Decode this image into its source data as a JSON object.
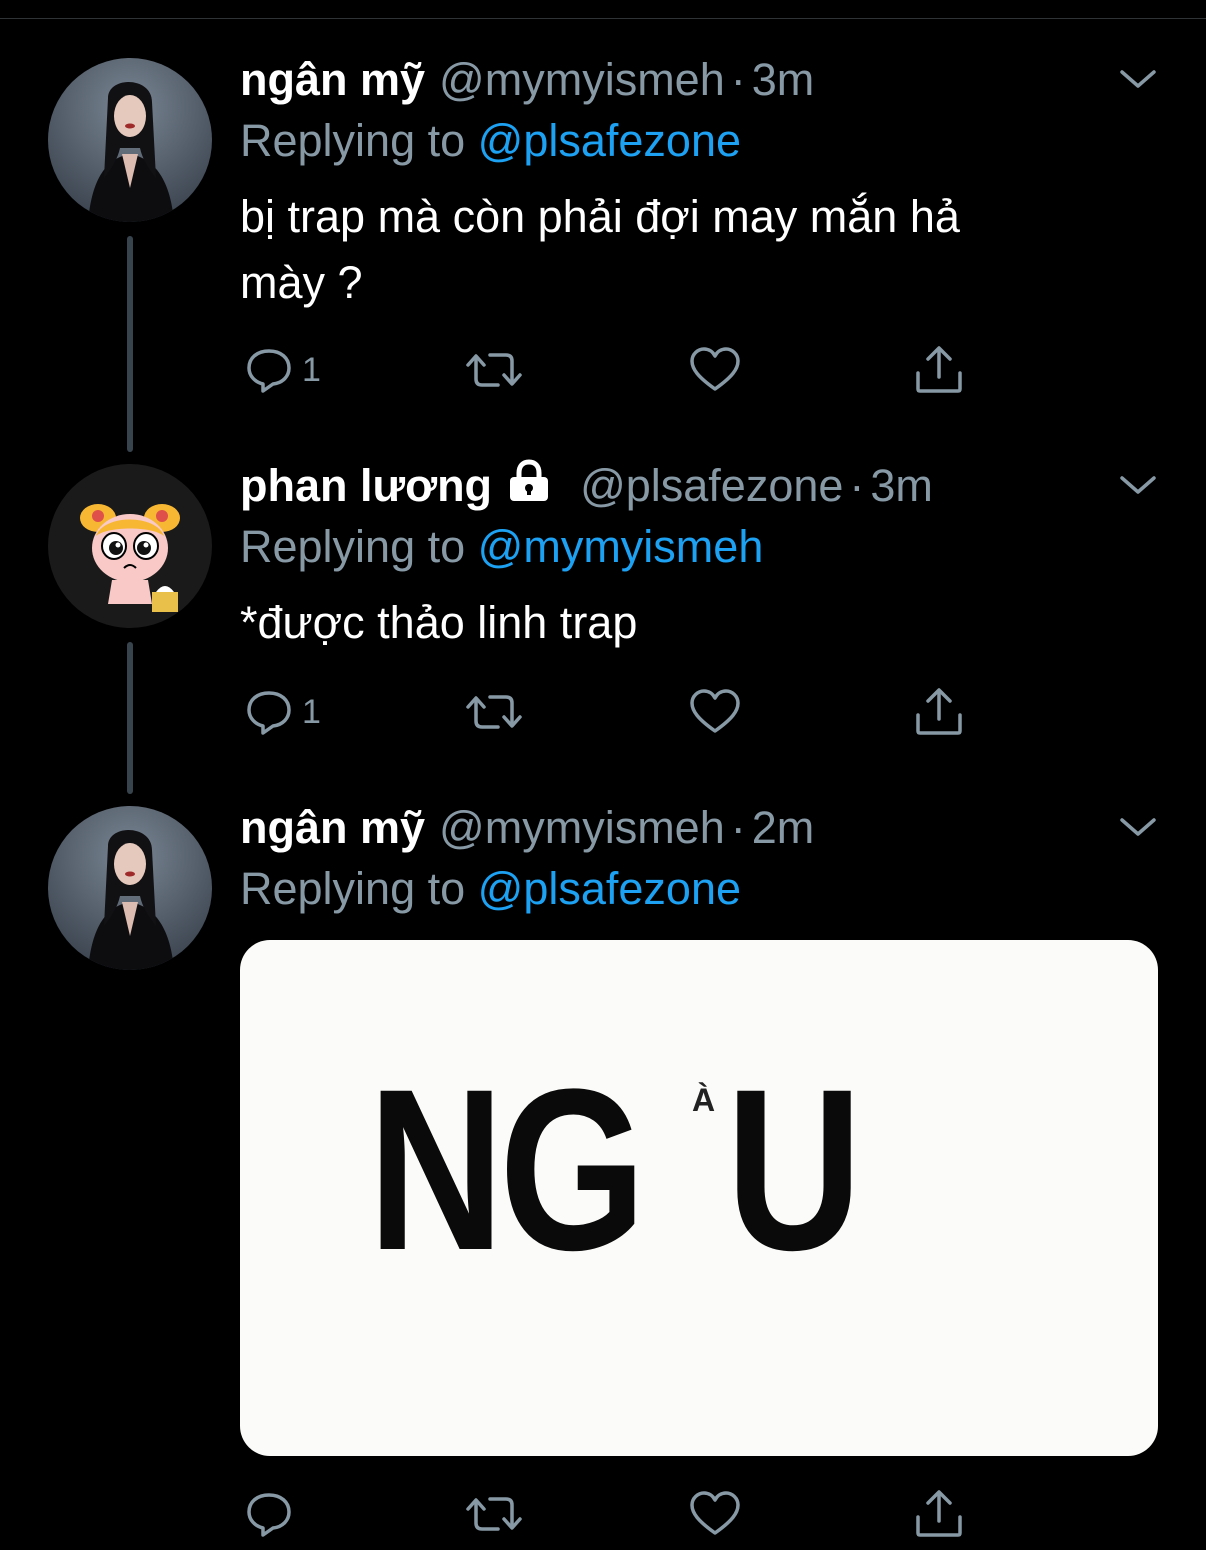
{
  "tweets": [
    {
      "name": "ngân mỹ",
      "handle": "@mymyismeh",
      "separator": "·",
      "time": "3m",
      "replying_prefix": "Replying to",
      "replying_to": "@plsafezone",
      "text": "bị trap mà còn phải đợi may mắn hả mày ?",
      "reply_count": "1"
    },
    {
      "name": "phan lương",
      "handle": "@plsafezone",
      "separator": "·",
      "time": "3m",
      "replying_prefix": "Replying to",
      "replying_to": "@mymyismeh",
      "text": "*được thảo linh trap",
      "reply_count": "1"
    },
    {
      "name": "ngân mỹ",
      "handle": "@mymyismeh",
      "separator": "·",
      "time": "2m",
      "replying_prefix": "Replying to",
      "replying_to": "@plsafezone",
      "image_text": {
        "left": "NG",
        "accent": "À",
        "right": "U"
      },
      "reply_count": ""
    }
  ],
  "colors": {
    "background": "#000000",
    "secondary_text": "#8899a6",
    "link": "#1da1f2",
    "thread_line": "#38444d"
  },
  "icons": [
    "reply-icon",
    "retweet-icon",
    "like-icon",
    "share-icon",
    "chevron-down-icon",
    "lock-icon"
  ]
}
